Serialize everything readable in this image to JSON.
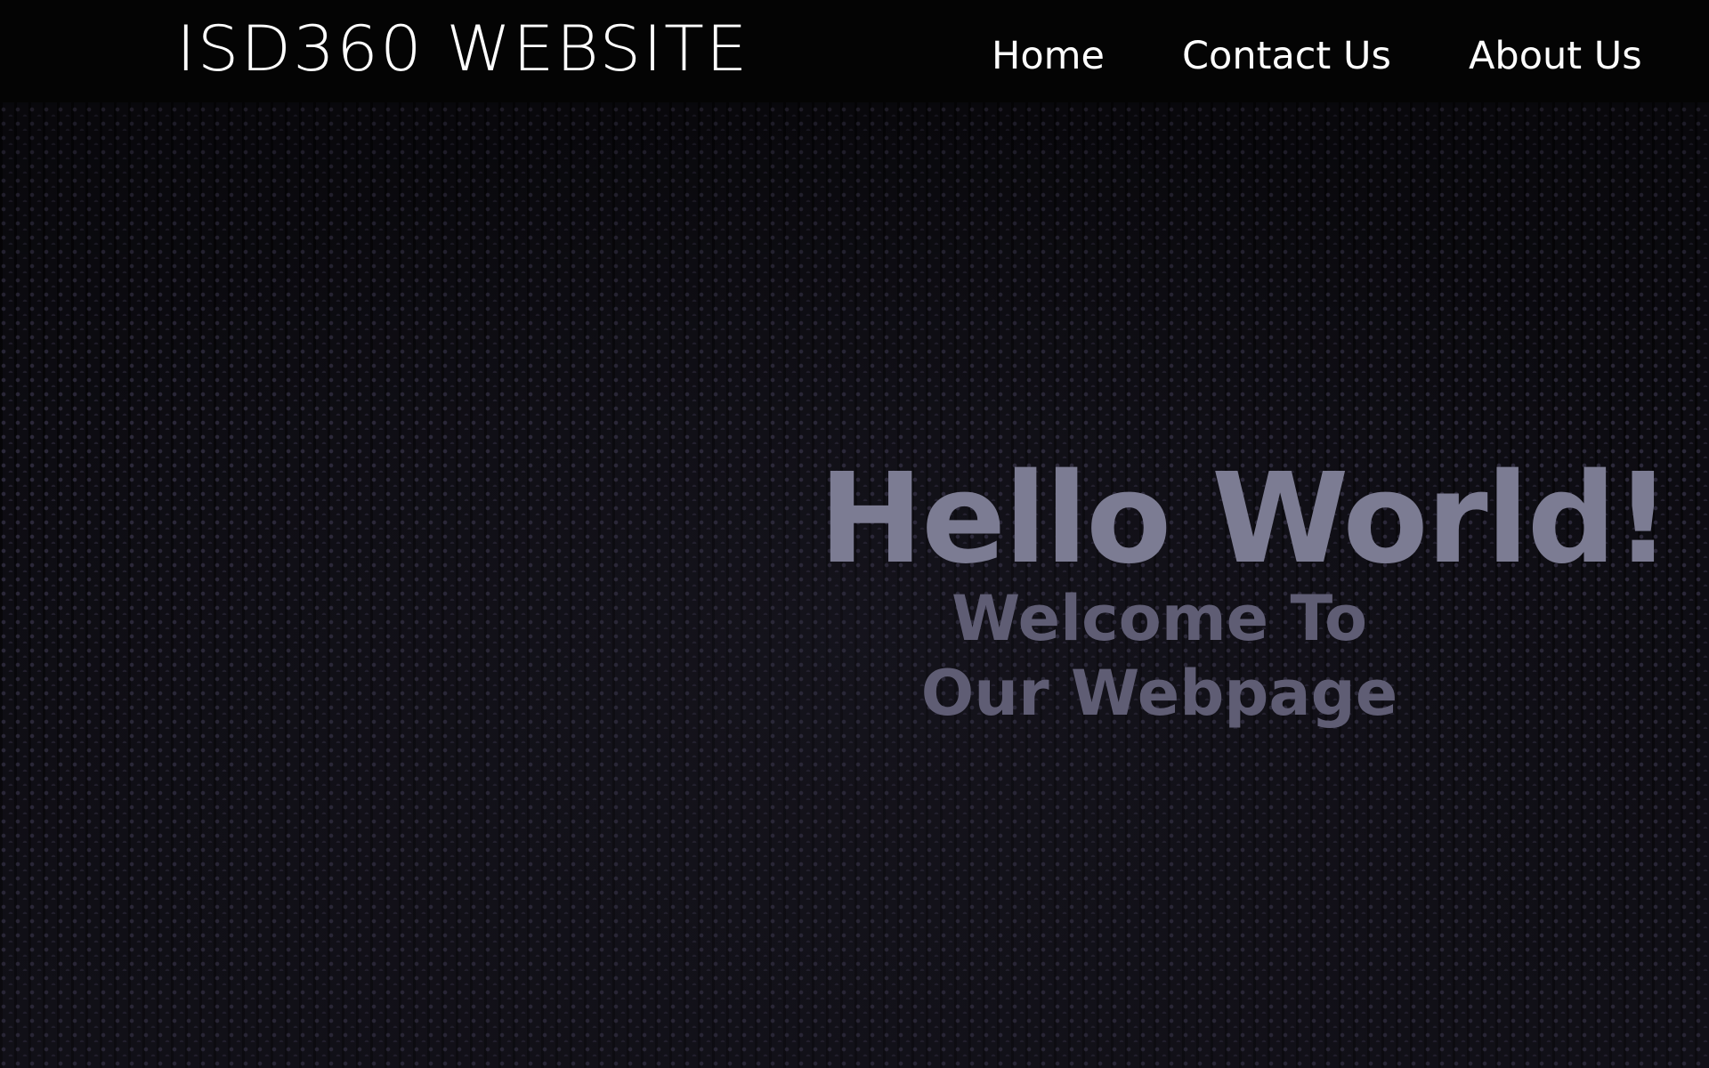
{
  "header": {
    "brand": "ISD360 WEBSITE",
    "nav": {
      "home": "Home",
      "contact": "Contact Us",
      "about": "About Us"
    }
  },
  "hero": {
    "title": "Hello World!",
    "subtitle": "Welcome To Our Webpage"
  },
  "colors": {
    "navbar_background": "#040404",
    "nav_text": "#ffffff",
    "hero_title": "#7c7c93",
    "hero_subtitle": "#5f5d74",
    "hero_background": "#0d0c12"
  }
}
